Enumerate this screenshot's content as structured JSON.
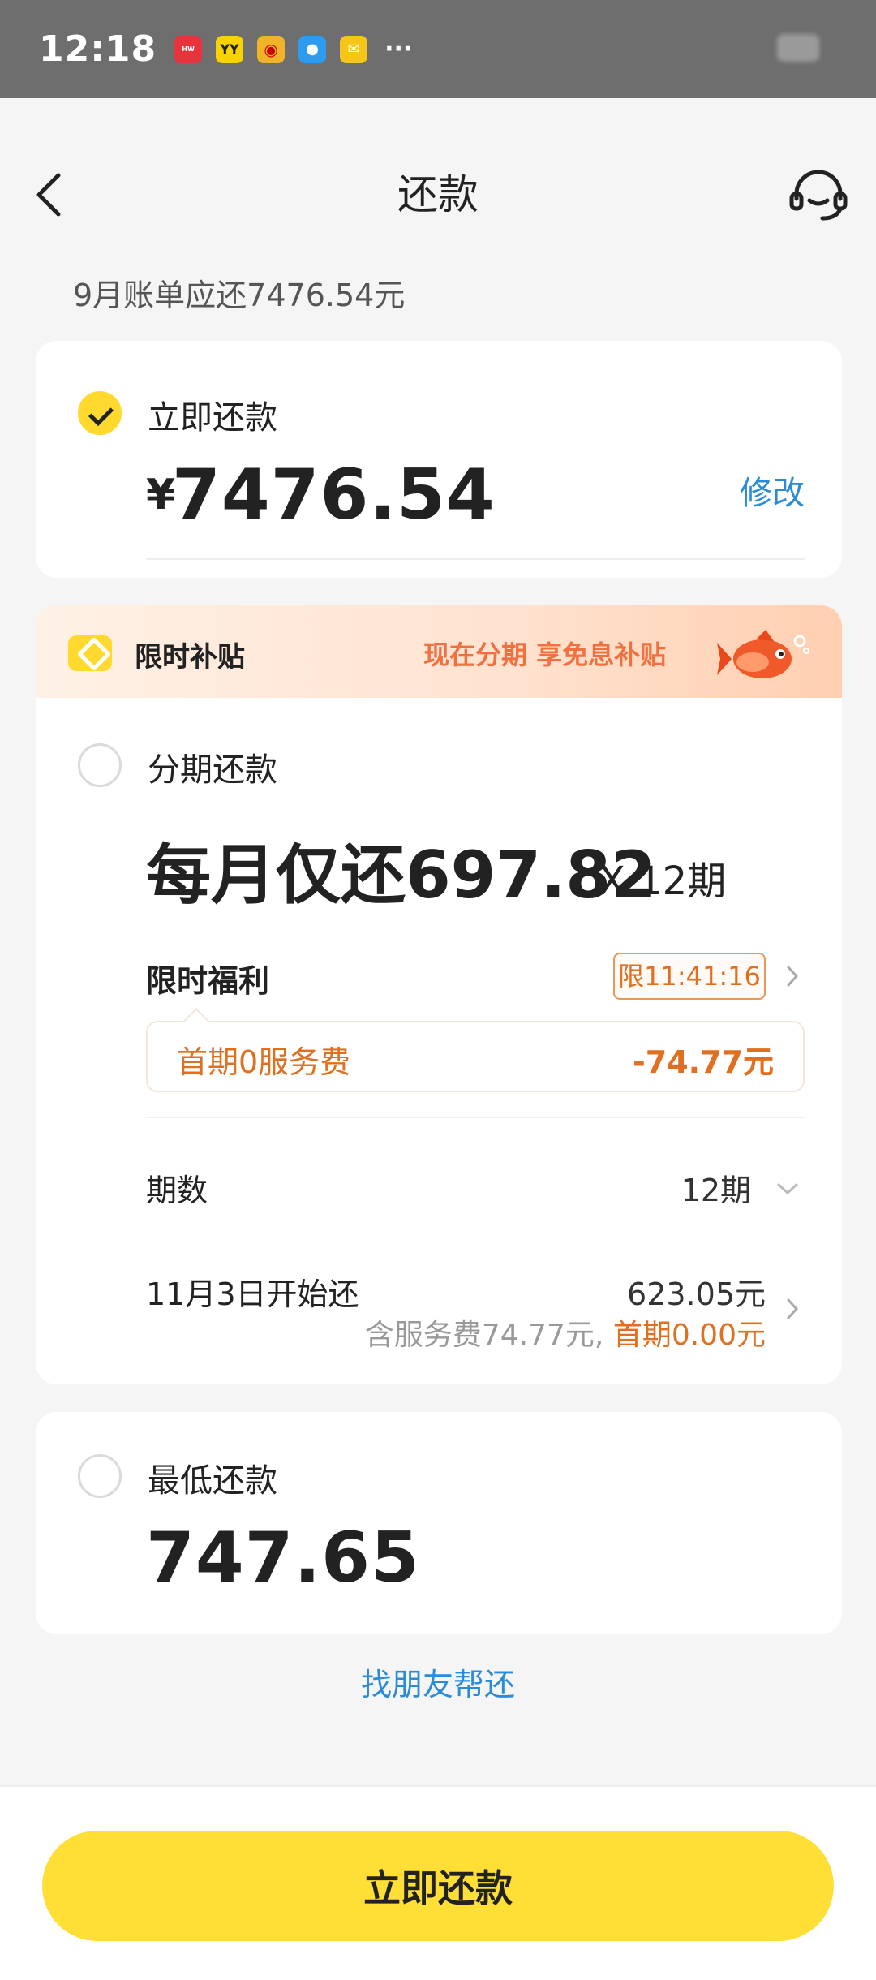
{
  "status_bar": {
    "time": "12:18",
    "app_icons": [
      "huawei-store-icon",
      "yy-icon",
      "weibo-icon",
      "messages-icon",
      "mail-icon"
    ],
    "more": "···"
  },
  "nav": {
    "title": "还款"
  },
  "bill_summary": "9月账单应还7476.54元",
  "pay_now": {
    "label": "立即还款",
    "currency": "¥",
    "amount": "7476.54",
    "edit": "修改",
    "selected": true
  },
  "promo": {
    "title": "限时补贴",
    "slogan": "现在分期 享免息补贴"
  },
  "installment": {
    "label": "分期还款",
    "monthly": "每月仅还697.82",
    "periods_suffix": "X 12期",
    "benefit_label": "限时福利",
    "timer": "限11:41:16",
    "benefit_name": "首期0服务费",
    "benefit_amount": "-74.77元",
    "periods_label": "期数",
    "periods_value": "12期",
    "start_label": "11月3日开始还",
    "start_amount": "623.05元",
    "start_fee": "含服务费74.77元,",
    "start_first": "首期0.00元"
  },
  "minimum": {
    "label": "最低还款",
    "amount": "747.65"
  },
  "friend_link": "找朋友帮还",
  "submit_button": "立即还款",
  "colors": {
    "accent_yellow": "#ffdf36",
    "link_blue": "#2a8bd6",
    "promo_orange": "#e07020"
  }
}
